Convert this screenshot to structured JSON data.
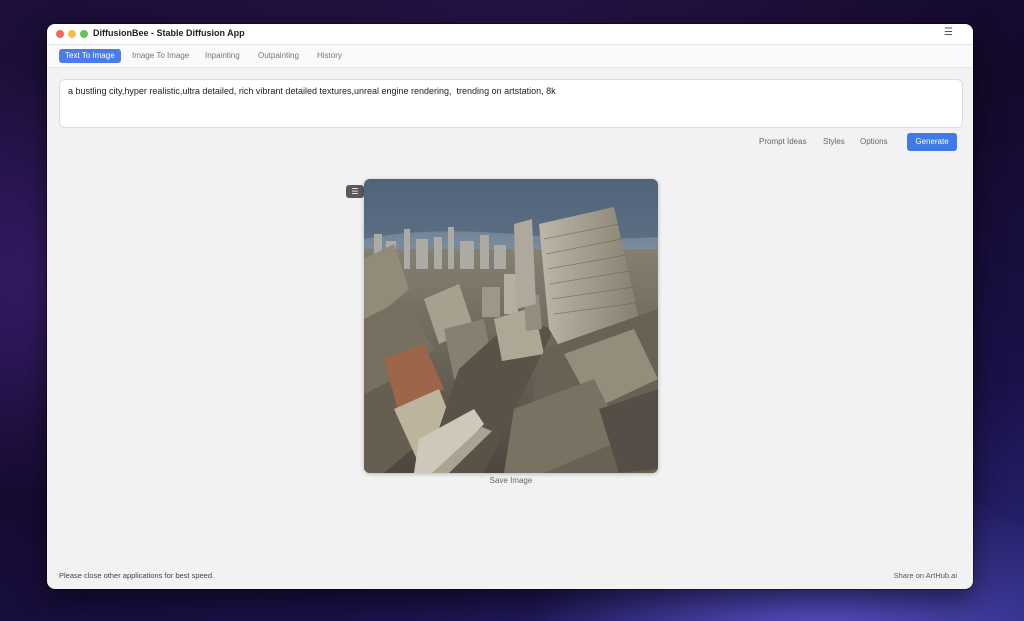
{
  "window": {
    "title": "DiffusionBee - Stable Diffusion App",
    "menu_icon": "hamburger-icon"
  },
  "tabs": [
    {
      "label": "Text To Image",
      "active": true
    },
    {
      "label": "Image To Image",
      "active": false
    },
    {
      "label": "Inpainting",
      "active": false
    },
    {
      "label": "Outpainting",
      "active": false
    },
    {
      "label": "History",
      "active": false
    }
  ],
  "prompt": {
    "value": "a bustling city,hyper realistic,ultra detailed, rich vibrant detailed textures,unreal engine rendering,  trending on artstation, 8k"
  },
  "actions": {
    "prompt_ideas": "Prompt Ideas",
    "styles": "Styles",
    "options": "Options",
    "generate": "Generate"
  },
  "result": {
    "image_icon": "city-render-image",
    "menu_icon": "hamburger-icon",
    "save_label": "Save Image"
  },
  "footer": {
    "hint": "Please close other applications for best speed.",
    "share": "Share on ArtHub.ai"
  },
  "colors": {
    "accent": "#4a7de9",
    "window_bg": "#f2f2f2"
  }
}
